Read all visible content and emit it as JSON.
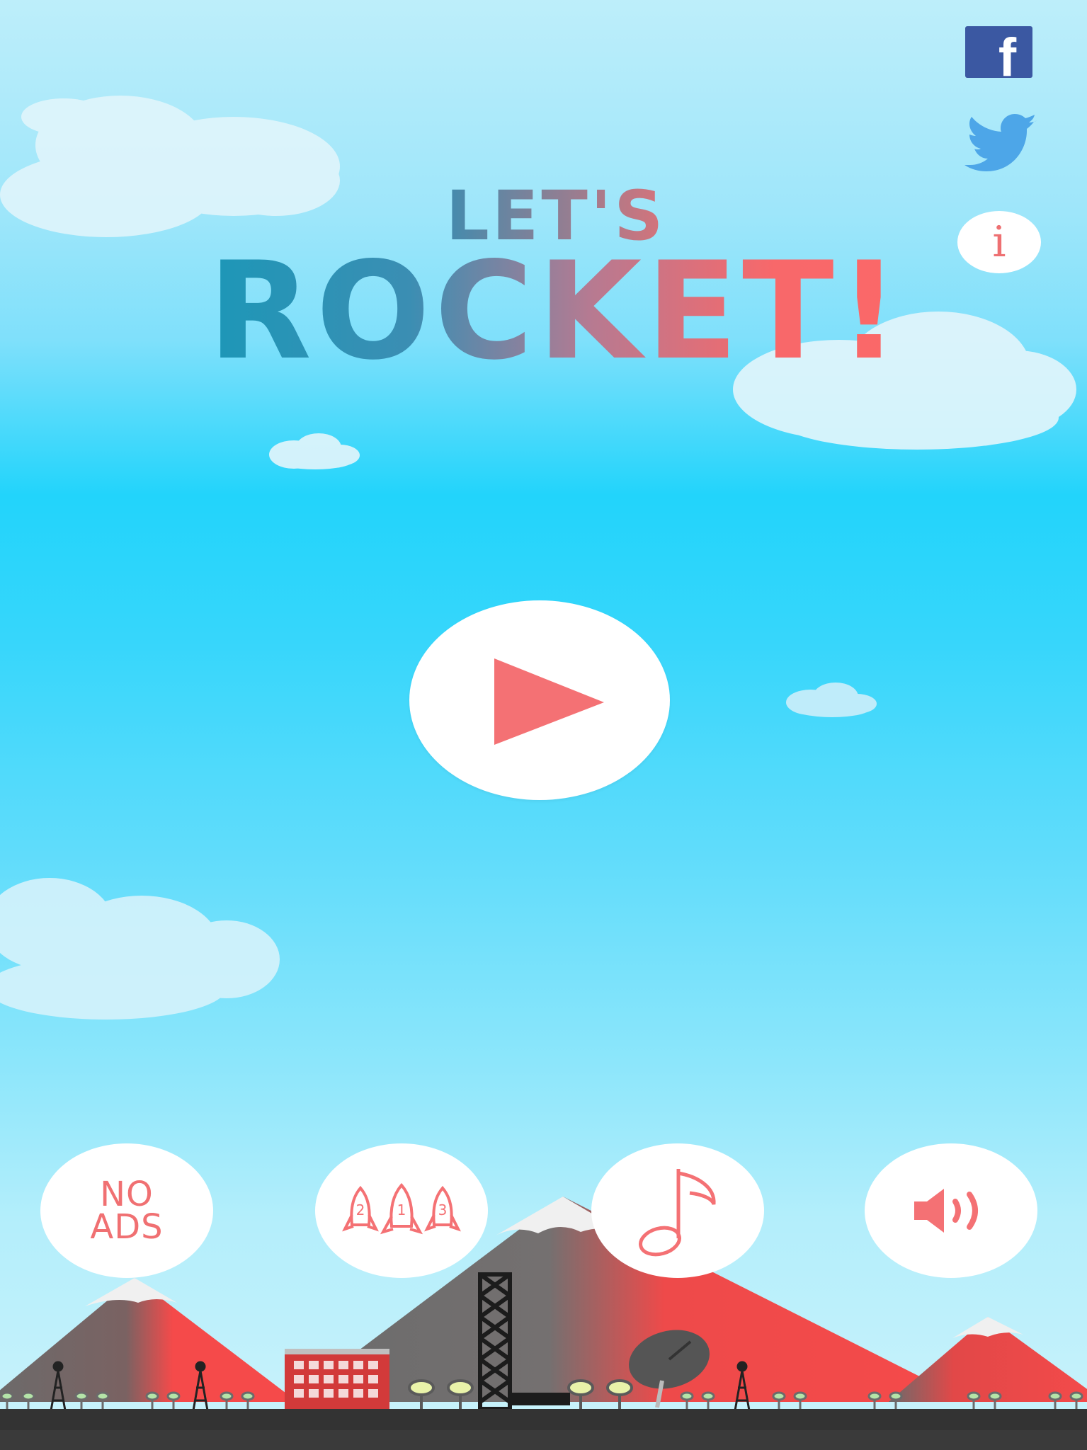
{
  "title": {
    "line1": "LET'S",
    "line2": "ROCKET!"
  },
  "social": {
    "facebook_glyph": "f",
    "info_glyph": "i",
    "icons": [
      "facebook-icon",
      "twitter-icon",
      "info-icon"
    ]
  },
  "play": {
    "icon": "play-icon"
  },
  "buttons": {
    "no_ads_line1": "NO",
    "no_ads_line2": "ADS",
    "rockets_numbers": [
      "2",
      "1",
      "3"
    ],
    "music_icon": "music-note-icon",
    "sound_icon": "speaker-icon"
  },
  "colors": {
    "accent": "#f47174",
    "sky_top": "#bdeefa",
    "sky_mid": "#22d4fb",
    "facebook": "#3b58a2",
    "twitter": "#4da6e8",
    "mountain_red": "#f54a4a",
    "mountain_gray": "#6b6b6b",
    "ground": "#333333"
  }
}
